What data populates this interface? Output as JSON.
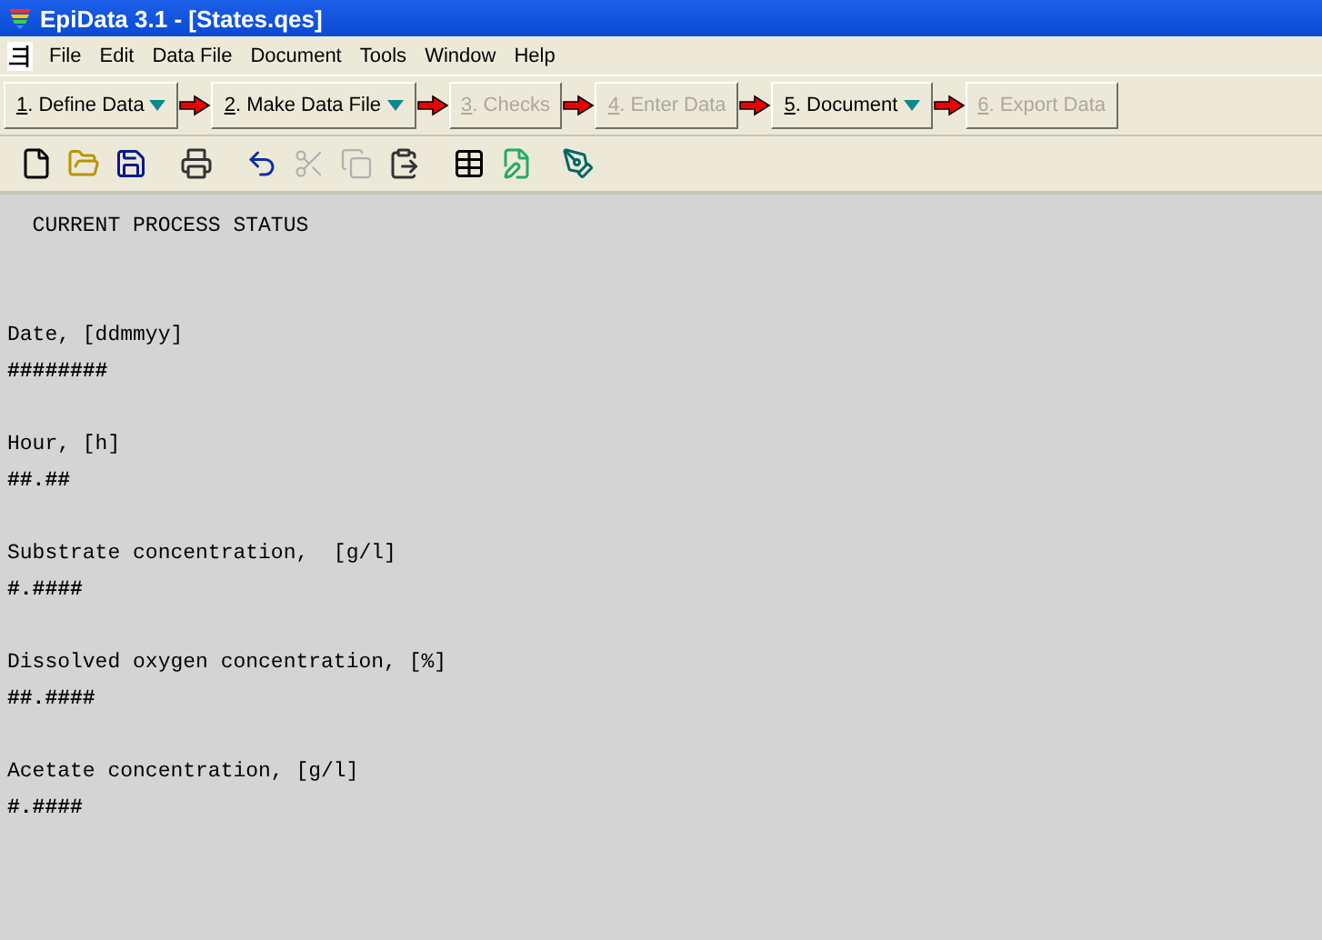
{
  "window": {
    "title": "EpiData 3.1 - [States.qes]"
  },
  "menu": [
    "File",
    "Edit",
    "Data File",
    "Document",
    "Tools",
    "Window",
    "Help"
  ],
  "workflow": [
    {
      "label": "1. Define Data",
      "disabled": false,
      "dropdown": true
    },
    {
      "label": "2. Make Data File",
      "disabled": false,
      "dropdown": true
    },
    {
      "label": "3. Checks",
      "disabled": true,
      "dropdown": false
    },
    {
      "label": "4. Enter Data",
      "disabled": true,
      "dropdown": false
    },
    {
      "label": "5. Document",
      "disabled": false,
      "dropdown": true
    },
    {
      "label": "6. Export Data",
      "disabled": true,
      "dropdown": false
    }
  ],
  "toolbar": [
    {
      "disabled": false
    },
    {
      "disabled": false
    },
    {
      "disabled": false
    },
    {
      "disabled": false
    },
    {
      "disabled": false
    },
    {
      "disabled": true
    },
    {
      "disabled": true
    },
    {
      "disabled": false
    },
    {
      "disabled": false
    },
    {
      "disabled": false
    },
    {
      "disabled": false
    }
  ],
  "document": {
    "heading": "CURRENT PROCESS STATUS",
    "fields": [
      {
        "label": "Date, [ddmmyy]",
        "mask": "########"
      },
      {
        "label": "Hour, [h]",
        "mask": "##.##"
      },
      {
        "label": "Substrate concentration,  [g/l]",
        "mask": "#.####"
      },
      {
        "label": "Dissolved oxygen concentration, [%]",
        "mask": "##.####"
      },
      {
        "label": "Acetate concentration, [g/l]",
        "mask": "#.####"
      }
    ]
  }
}
